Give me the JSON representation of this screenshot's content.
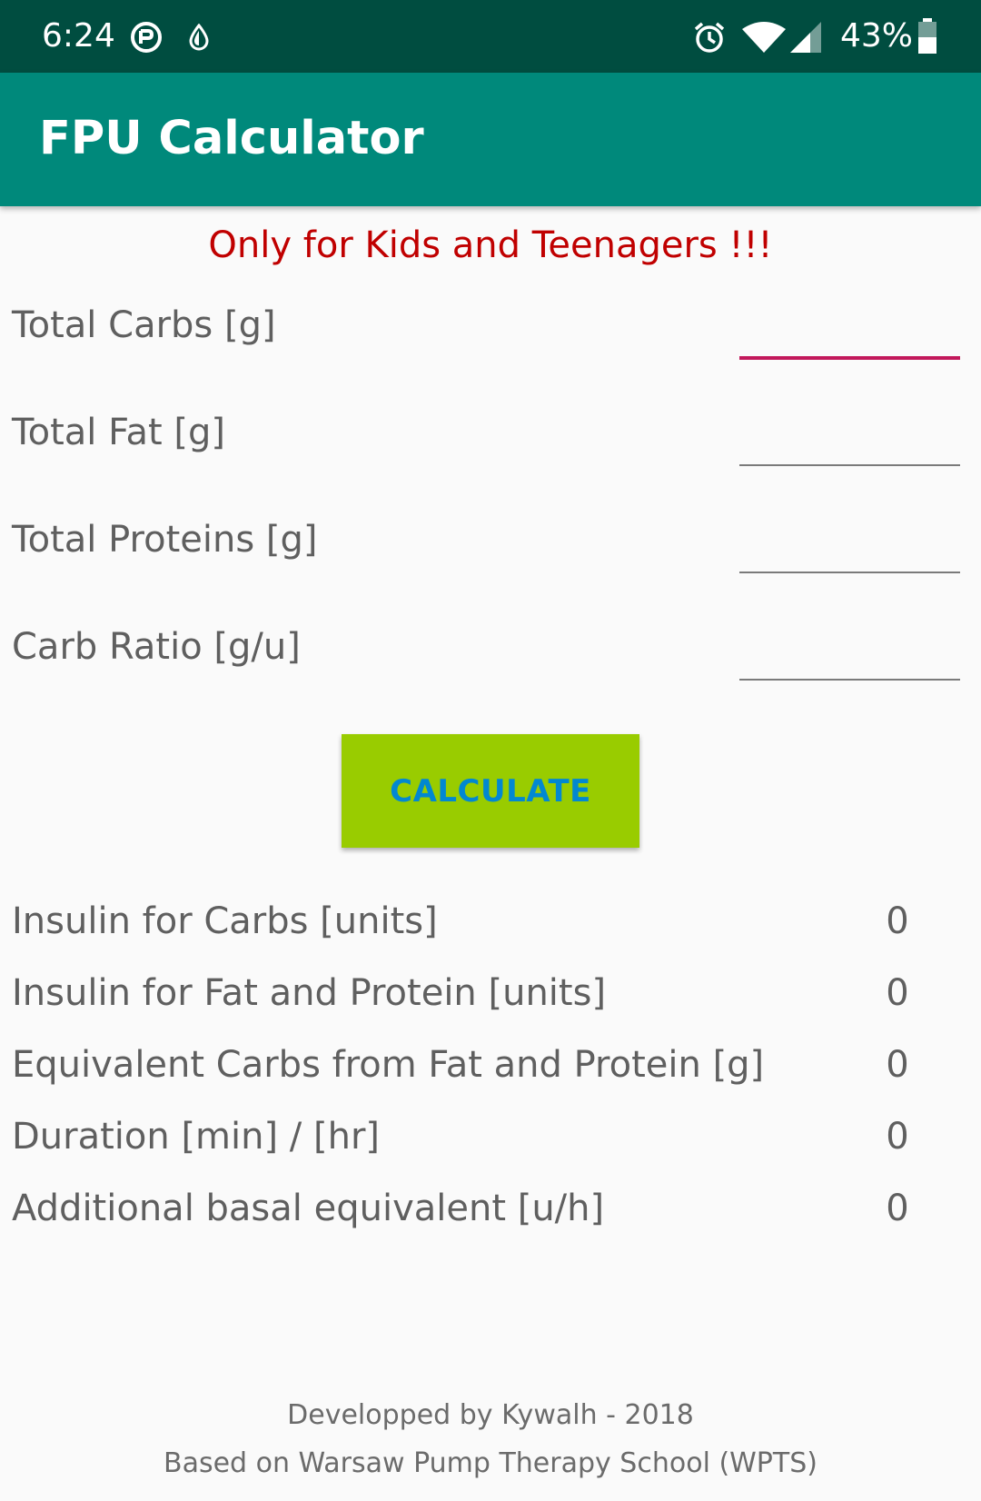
{
  "status_bar": {
    "time": "6:24",
    "battery_percent": "43%",
    "icons": [
      "vpn-key-icon",
      "water-drop-icon",
      "alarm-icon",
      "wifi-icon",
      "signal-icon",
      "battery-icon"
    ],
    "background": "#004d40"
  },
  "app_bar": {
    "title": "FPU Calculator",
    "background": "#00897b"
  },
  "warning": {
    "text": "Only for Kids and Teenagers !!!",
    "color": "#c00000"
  },
  "inputs": [
    {
      "label": "Total Carbs [g]",
      "value": "",
      "focused": true
    },
    {
      "label": "Total Fat [g]",
      "value": "",
      "focused": false
    },
    {
      "label": "Total Proteins [g]",
      "value": "",
      "focused": false
    },
    {
      "label": "Carb Ratio [g/u]",
      "value": "",
      "focused": false
    }
  ],
  "calculate_button": {
    "label": "CALCULATE",
    "background": "#99cc00",
    "text_color": "#0288d1"
  },
  "results": [
    {
      "label": "Insulin for Carbs [units]",
      "value": "0"
    },
    {
      "label": "Insulin for Fat and Protein [units]",
      "value": "0"
    },
    {
      "label": "Equivalent Carbs from Fat and Protein [g]",
      "value": "0"
    },
    {
      "label": "Duration [min] / [hr]",
      "value": "0"
    },
    {
      "label": "Additional basal equivalent [u/h]",
      "value": "0"
    }
  ],
  "footer": {
    "line1": "Developped by Kywalh - 2018",
    "line2": "Based on Warsaw Pump Therapy School (WPTS)"
  },
  "colors": {
    "focus_underline": "#c2185b",
    "input_underline": "#7a7a7a",
    "label_text": "#5f5f5f"
  }
}
